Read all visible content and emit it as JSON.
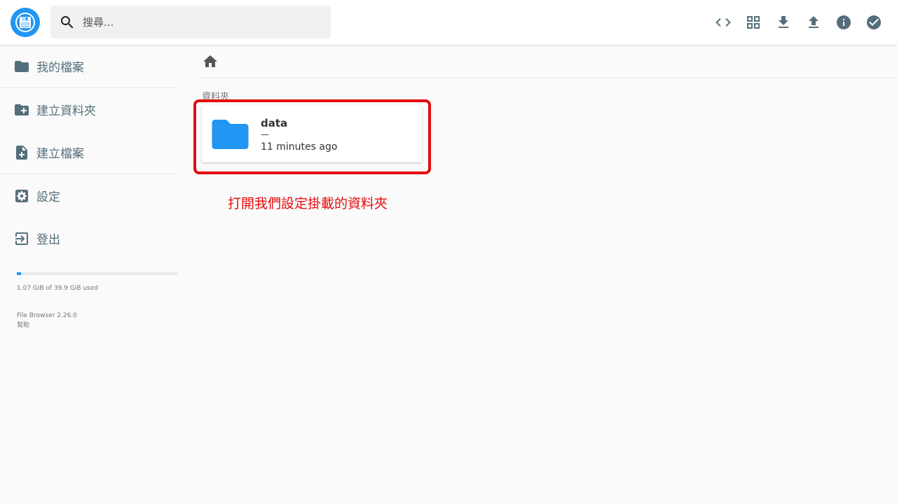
{
  "header": {
    "logo_icon": "floppy-disk-icon",
    "search": {
      "placeholder": "搜尋...",
      "value": "",
      "icon": "search-icon"
    },
    "actions": [
      {
        "name": "code-icon"
      },
      {
        "name": "grid-view-icon"
      },
      {
        "name": "download-icon"
      },
      {
        "name": "upload-icon"
      },
      {
        "name": "info-icon"
      },
      {
        "name": "check-circle-icon"
      }
    ]
  },
  "sidebar": {
    "items": [
      {
        "label": "我的檔案",
        "icon": "folder-icon"
      },
      {
        "label": "建立資料夾",
        "icon": "create-folder-icon"
      },
      {
        "label": "建立檔案",
        "icon": "note-add-icon"
      },
      {
        "label": "設定",
        "icon": "settings-icon"
      },
      {
        "label": "登出",
        "icon": "exit-icon"
      }
    ],
    "quota": {
      "used_fraction": 0.027,
      "text": "1.07 GiB of 39.9 GiB used"
    },
    "credits": {
      "version": "File Browser 2.26.0",
      "help": "幫助"
    }
  },
  "main": {
    "breadcrumb_icon": "home-icon",
    "section_title": "資料夾",
    "items": [
      {
        "name": "data",
        "size": "—",
        "modified": "11 minutes ago",
        "icon": "folder-icon"
      }
    ],
    "annotation": "打開我們設定掛載的資料夾"
  },
  "colors": {
    "accent": "#2196f3",
    "icon_gray": "#546e7a",
    "annotation_red": "#e50c0c"
  }
}
